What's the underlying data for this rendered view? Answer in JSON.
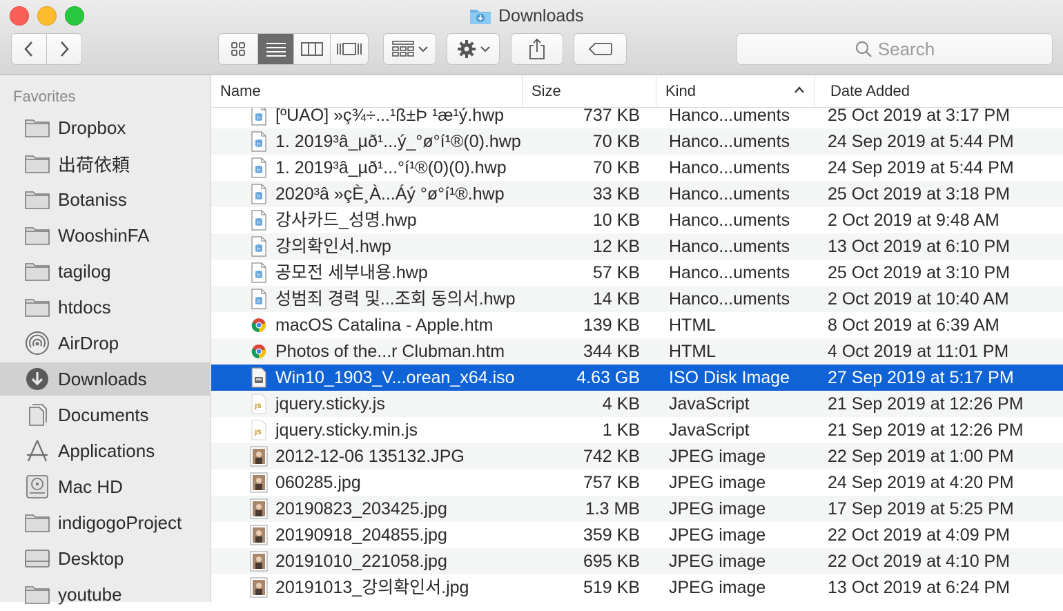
{
  "window": {
    "title": "Downloads"
  },
  "toolbar": {
    "search_placeholder": "Search"
  },
  "sidebar": {
    "heading": "Favorites",
    "items": [
      {
        "label": "Dropbox",
        "icon": "folder-icon"
      },
      {
        "label": "出荷依頼",
        "icon": "folder-icon"
      },
      {
        "label": "Botaniss",
        "icon": "folder-icon"
      },
      {
        "label": "WooshinFA",
        "icon": "folder-icon"
      },
      {
        "label": "tagilog",
        "icon": "folder-icon"
      },
      {
        "label": "htdocs",
        "icon": "folder-icon"
      },
      {
        "label": "AirDrop",
        "icon": "airdrop-icon"
      },
      {
        "label": "Downloads",
        "icon": "downloads-icon",
        "selected": true
      },
      {
        "label": "Documents",
        "icon": "documents-icon"
      },
      {
        "label": "Applications",
        "icon": "applications-icon"
      },
      {
        "label": "Mac HD",
        "icon": "hard-drive-icon"
      },
      {
        "label": "indigogoProject",
        "icon": "folder-icon"
      },
      {
        "label": "Desktop",
        "icon": "desktop-icon"
      },
      {
        "label": "youtube",
        "icon": "folder-icon"
      }
    ]
  },
  "columns": {
    "name": "Name",
    "size": "Size",
    "kind": "Kind",
    "date": "Date Added"
  },
  "files": [
    {
      "name": "[ºÙÀÓ] »ç¾÷...¹ß±Þ ¹æ¹ý.hwp",
      "size": "737 KB",
      "kind": "Hanco...uments",
      "date": "25 Oct 2019 at 3:17 PM",
      "icon": "hwp-document-icon"
    },
    {
      "name": "1. 2019³â_µð¹...ý_°ø°í¹®(0).hwp",
      "size": "70 KB",
      "kind": "Hanco...uments",
      "date": "24 Sep 2019 at 5:44 PM",
      "icon": "hwp-document-icon"
    },
    {
      "name": "1. 2019³â_µð¹...°í¹®(0)(0).hwp",
      "size": "70 KB",
      "kind": "Hanco...uments",
      "date": "24 Sep 2019 at 5:44 PM",
      "icon": "hwp-document-icon"
    },
    {
      "name": "2020³â »çÈ¸À...Áý °ø°í¹®.hwp",
      "size": "33 KB",
      "kind": "Hanco...uments",
      "date": "25 Oct 2019 at 3:18 PM",
      "icon": "hwp-document-icon"
    },
    {
      "name": "강사카드_성명.hwp",
      "size": "10 KB",
      "kind": "Hanco...uments",
      "date": "2 Oct 2019 at 9:48 AM",
      "icon": "hwp-document-icon"
    },
    {
      "name": "강의확인서.hwp",
      "size": "12 KB",
      "kind": "Hanco...uments",
      "date": "13 Oct 2019 at 6:10 PM",
      "icon": "hwp-document-icon"
    },
    {
      "name": "공모전 세부내용.hwp",
      "size": "57 KB",
      "kind": "Hanco...uments",
      "date": "25 Oct 2019 at 3:10 PM",
      "icon": "hwp-document-icon"
    },
    {
      "name": "성범죄 경력 및...조회 동의서.hwp",
      "size": "14 KB",
      "kind": "Hanco...uments",
      "date": "2 Oct 2019 at 10:40 AM",
      "icon": "hwp-document-icon"
    },
    {
      "name": "macOS Catalina - Apple.htm",
      "size": "139 KB",
      "kind": "HTML",
      "date": "8 Oct 2019 at 6:39 AM",
      "icon": "chrome-html-icon"
    },
    {
      "name": "Photos of the...r Clubman.htm",
      "size": "344 KB",
      "kind": "HTML",
      "date": "4 Oct 2019 at 11:01 PM",
      "icon": "chrome-html-icon"
    },
    {
      "name": "Win10_1903_V...orean_x64.iso",
      "size": "4.63 GB",
      "kind": "ISO Disk Image",
      "date": "27 Sep 2019 at 5:17 PM",
      "icon": "disk-image-icon",
      "selected": true
    },
    {
      "name": "jquery.sticky.js",
      "size": "4 KB",
      "kind": "JavaScript",
      "date": "21 Sep 2019 at 12:26 PM",
      "icon": "javascript-file-icon"
    },
    {
      "name": "jquery.sticky.min.js",
      "size": "1 KB",
      "kind": "JavaScript",
      "date": "21 Sep 2019 at 12:26 PM",
      "icon": "javascript-file-icon"
    },
    {
      "name": "2012-12-06 135132.JPG",
      "size": "742 KB",
      "kind": "JPEG image",
      "date": "22 Sep 2019 at 1:00 PM",
      "icon": "jpeg-thumbnail-icon"
    },
    {
      "name": "060285.jpg",
      "size": "757 KB",
      "kind": "JPEG image",
      "date": "24 Sep 2019 at 4:20 PM",
      "icon": "jpeg-thumbnail-icon"
    },
    {
      "name": "20190823_203425.jpg",
      "size": "1.3 MB",
      "kind": "JPEG image",
      "date": "17 Sep 2019 at 5:25 PM",
      "icon": "jpeg-thumbnail-icon"
    },
    {
      "name": "20190918_204855.jpg",
      "size": "359 KB",
      "kind": "JPEG image",
      "date": "22 Oct 2019 at 4:09 PM",
      "icon": "jpeg-thumbnail-icon"
    },
    {
      "name": "20191010_221058.jpg",
      "size": "695 KB",
      "kind": "JPEG image",
      "date": "22 Oct 2019 at 4:10 PM",
      "icon": "jpeg-thumbnail-icon"
    },
    {
      "name": "20191013_강의확인서.jpg",
      "size": "519 KB",
      "kind": "JPEG image",
      "date": "13 Oct 2019 at 6:24 PM",
      "icon": "jpeg-thumbnail-icon"
    }
  ],
  "colors": {
    "selection": "#0f63d6",
    "sidebar_bg": "#ececec",
    "sidebar_selected": "#d1d1d1"
  }
}
